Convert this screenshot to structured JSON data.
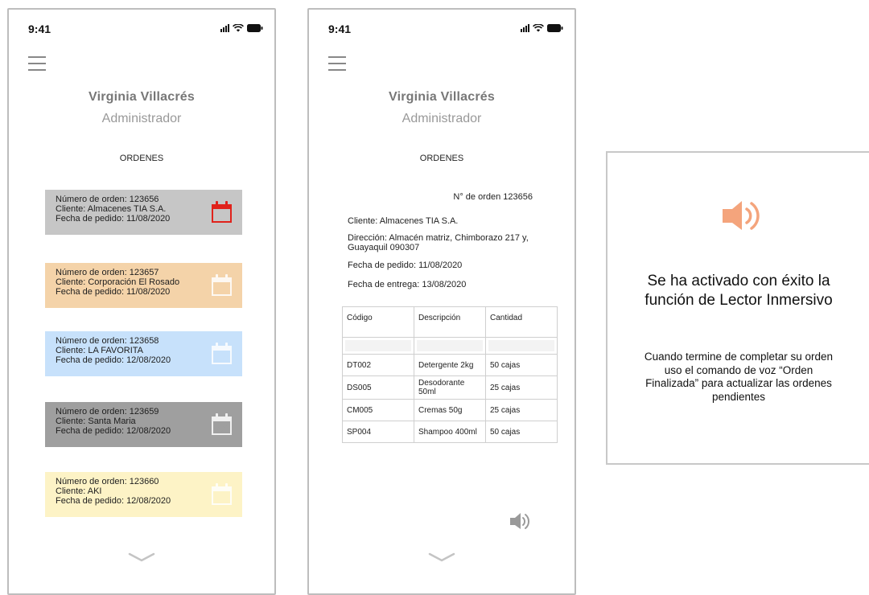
{
  "status_bar": {
    "time": "9:41"
  },
  "user": {
    "name": "Virginia Villacrés",
    "role": "Administrador"
  },
  "orders_screen": {
    "section_title": "ORDENES",
    "orders": [
      {
        "number_line": "Número de orden: 123656",
        "client_line": "Cliente: Almacenes TIA S.A.",
        "date_line": "Fecha de pedido: 11/08/2020",
        "bg_color": "#c6c6c6",
        "icon": "calendar-check-icon",
        "icon_color": "#e0221b"
      },
      {
        "number_line": "Número de orden: 123657",
        "client_line": "Cliente: Corporación El Rosado",
        "date_line": "Fecha de pedido: 11/08/2020",
        "bg_color": "#f4d3a9",
        "icon": "calendar-check-icon",
        "icon_color": "#ffffff"
      },
      {
        "number_line": "Número de orden: 123658",
        "client_line": "Cliente: LA FAVORITA",
        "date_line": "Fecha de pedido: 12/08/2020",
        "bg_color": "#c7e1fb",
        "icon": "calendar-check-icon",
        "icon_color": "#ffffff"
      },
      {
        "number_line": "Número de orden: 123659",
        "client_line": "Cliente: Santa Maria",
        "date_line": "Fecha de pedido: 12/08/2020",
        "bg_color": "#9f9f9f",
        "icon": "calendar-check-icon",
        "icon_color": "#ffffff"
      },
      {
        "number_line": "Número de orden: 123660",
        "client_line": "Cliente: AKI",
        "date_line": "Fecha de pedido: 12/08/2020",
        "bg_color": "#fdf3c6",
        "icon": "calendar-check-icon",
        "icon_color": "#ffffff"
      }
    ]
  },
  "order_detail": {
    "section_title": "ORDENES",
    "order_number": "N° de orden 123656",
    "client": "Cliente: Almacenes TIA S.A.",
    "address": "Dirección:  Almacén matriz, Chimborazo 217 y, Guayaquil 090307",
    "order_date": "Fecha de pedido: 11/08/2020",
    "delivery_date": "Fecha de entrega: 13/08/2020",
    "table": {
      "headers": [
        "Código",
        "Descripción",
        "Cantidad"
      ],
      "rows": [
        [
          "DT002",
          "Detergente 2kg",
          "50 cajas"
        ],
        [
          "DS005",
          "Desodorante 50ml",
          "25 cajas"
        ],
        [
          "CM005",
          "Cremas 50g",
          "25 cajas"
        ],
        [
          "SP004",
          "Shampoo 400ml",
          "50 cajas"
        ]
      ]
    }
  },
  "notice": {
    "title": "Se ha activado con éxito la función de Lector Inmersivo",
    "body": "Cuando termine de completar su orden uso el comando de voz “Orden Finalizada” para actualizar las ordenes pendientes",
    "icon": "speaker-icon",
    "icon_color": "#f4a47c"
  },
  "colors": {
    "frame_border": "#bdbdbd",
    "muted_text": "#777777"
  }
}
